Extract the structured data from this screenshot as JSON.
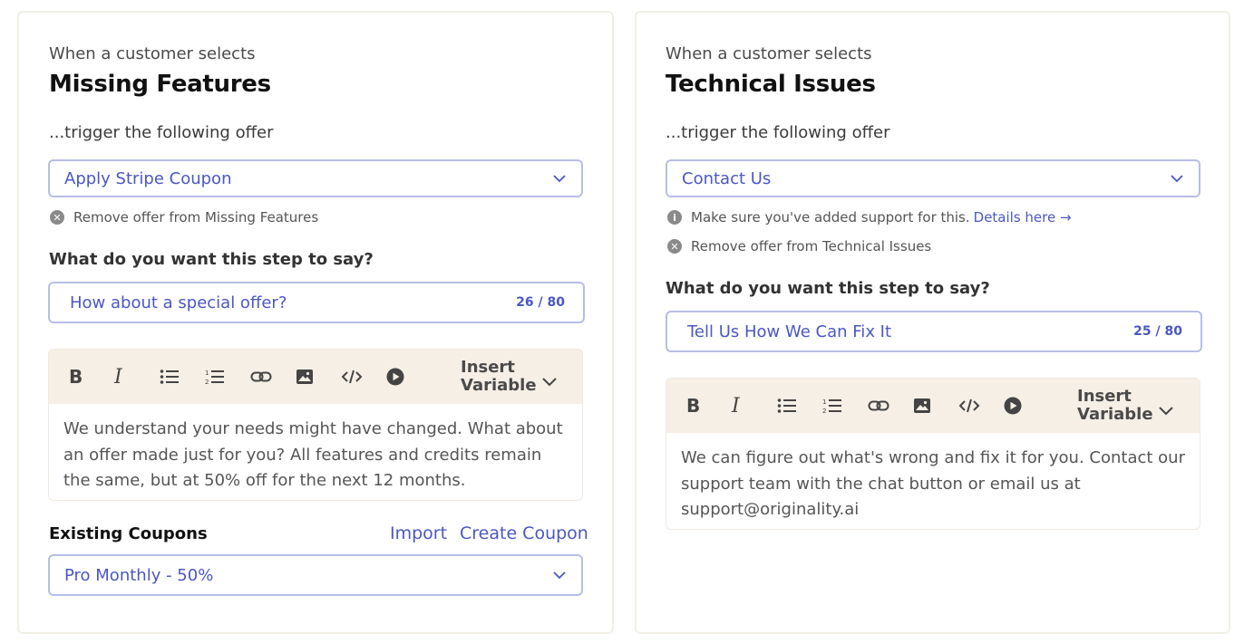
{
  "left": {
    "when_label": "When a customer selects",
    "reason": "Missing Features",
    "trigger_label": "...trigger the following offer",
    "offer_select": "Apply Stripe Coupon",
    "remove_offer": "Remove offer from Missing Features",
    "step_question": "What do you want this step to say?",
    "headline": "How about a special offer?",
    "headline_count": "26 / 80",
    "insert_variable": "Insert\nVariable",
    "body_text": "We understand your needs might have changed. What about an offer made just for you? All features and credits remain the same, but at 50% off for the next 12 months.",
    "existing_coupons_label": "Existing Coupons",
    "import_link": "Import",
    "create_coupon_link": "Create Coupon",
    "coupon_select": "Pro Monthly - 50%"
  },
  "right": {
    "when_label": "When a customer selects",
    "reason": "Technical Issues",
    "trigger_label": "...trigger the following offer",
    "offer_select": "Contact Us",
    "info_note": "Make sure you've added support for this.",
    "info_link": "Details here →",
    "remove_offer": "Remove offer from Technical Issues",
    "step_question": "What do you want this step to say?",
    "headline": "Tell Us How We Can Fix It",
    "headline_count": "25 / 80",
    "insert_variable": "Insert\nVariable",
    "body_text": "We can figure out what's wrong and fix it for you. Contact our support team with the chat button or email us at support@originality.ai"
  },
  "toolbar_icons": [
    "bold-icon",
    "italic-icon",
    "bullet-list-icon",
    "numbered-list-icon",
    "link-icon",
    "image-icon",
    "code-icon",
    "video-icon"
  ],
  "colors": {
    "accent": "#4a57c4",
    "border": "#b8bde6",
    "toolbar_bg": "#f6efe5",
    "card_border": "#f1efe4"
  }
}
